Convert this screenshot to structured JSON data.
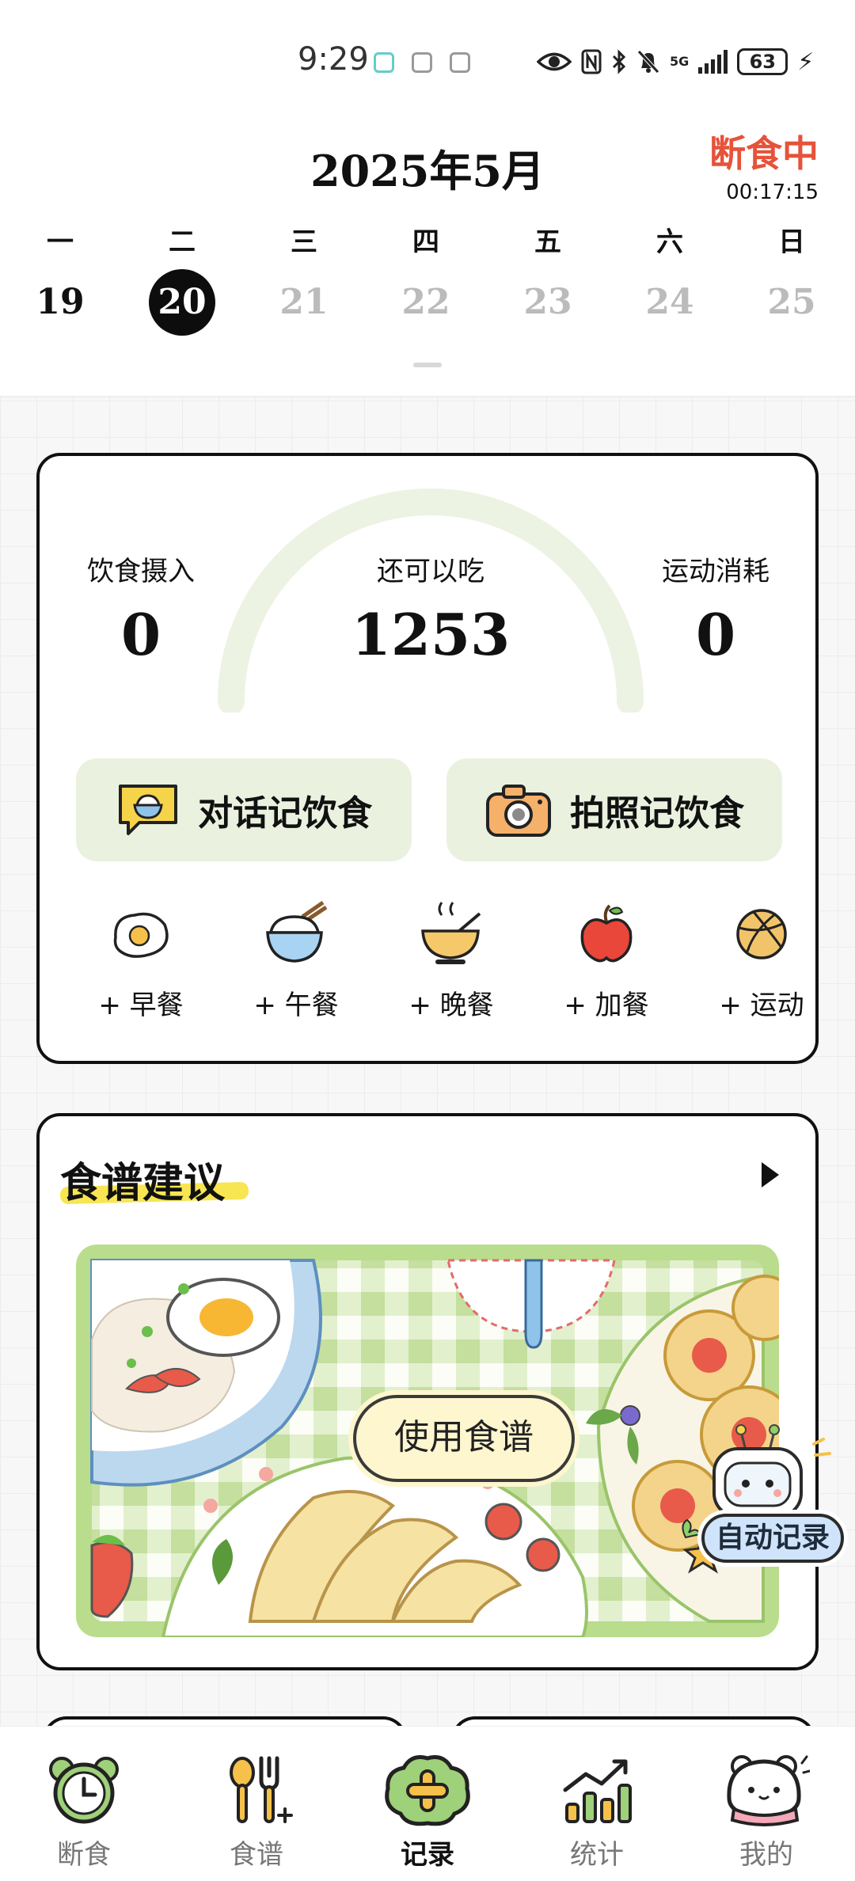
{
  "status_bar": {
    "time": "9:29",
    "network": "5G",
    "battery": "63"
  },
  "calendar": {
    "month_title": "2025年5月",
    "fasting_status": "断食中",
    "fasting_timer": "00:17:15",
    "weekdays": [
      "一",
      "二",
      "三",
      "四",
      "五",
      "六",
      "日"
    ],
    "days": [
      "19",
      "20",
      "21",
      "22",
      "23",
      "24",
      "25"
    ],
    "selected_day": "20"
  },
  "summary": {
    "intake_label": "饮食摄入",
    "intake_value": "0",
    "remaining_label": "还可以吃",
    "remaining_value": "1253",
    "burned_label": "运动消耗",
    "burned_value": "0",
    "chat_log_label": "对话记饮食",
    "photo_log_label": "拍照记饮食",
    "meals": [
      "+ 早餐",
      "+ 午餐",
      "+ 晚餐",
      "+ 加餐",
      "+ 运动"
    ]
  },
  "recipe": {
    "title": "食谱建议",
    "use_button": "使用食谱",
    "auto_record": "自动记录"
  },
  "nav": {
    "items": [
      "断食",
      "食谱",
      "记录",
      "统计",
      "我的"
    ],
    "active": "记录"
  },
  "colors": {
    "accent_red": "#e5533a",
    "button_green": "#eaf2df",
    "gauge_track": "#edf3e3",
    "recipe_frame": "#b9dd8c",
    "highlight_yellow": "#f7e552"
  }
}
